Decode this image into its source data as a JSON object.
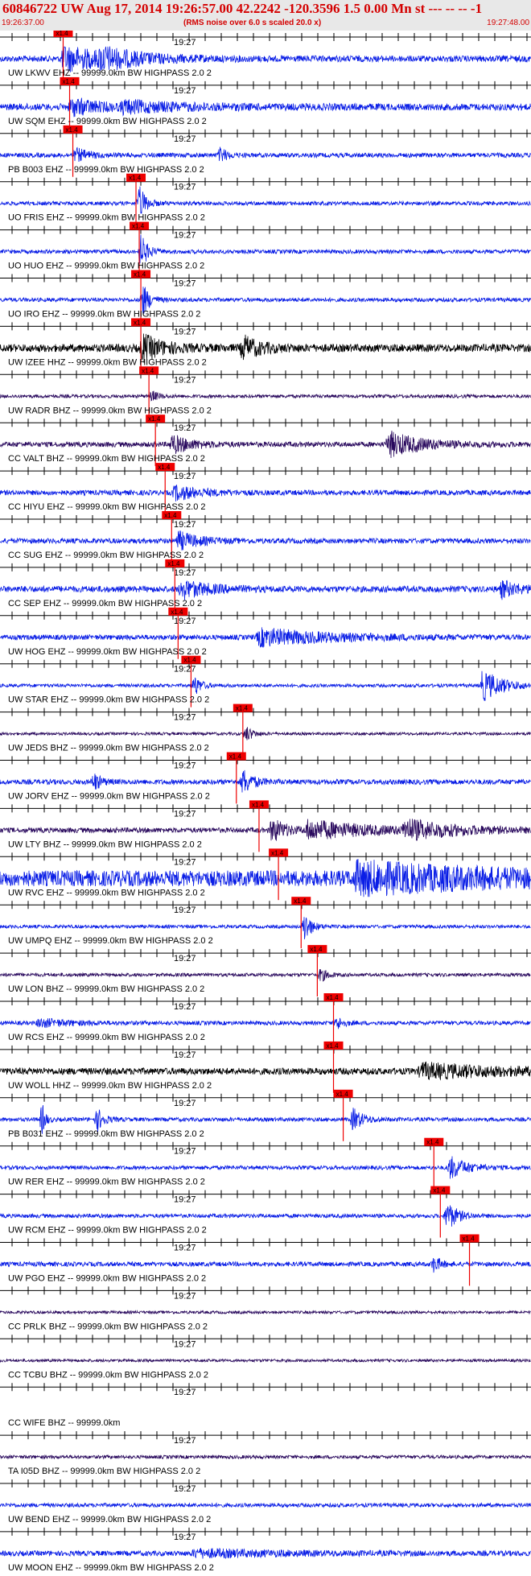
{
  "header": {
    "title": "60846722 UW Aug 17, 2014 19:26:57.00   42.2242 -120.3596  1.5 0.00 Mn st --- -- --   -1",
    "subtitle": "(RMS noise over 6.0 s scaled 20.0 x)",
    "start_time": "19:26:37.00",
    "end_time": "19:27:48.00"
  },
  "chart_data": {
    "type": "line",
    "title": "60846722 UW Aug 17, 2014 19:26:57.00   42.2242 -120.3596  1.5 0.00 Mn st --- -- --   -1",
    "subtitle": "(RMS noise over 6.0 s scaled 20.0 x)",
    "x_range": [
      "19:26:37.00",
      "19:27:48.00"
    ],
    "minute_marker_label": "19:27",
    "pick_label": "x1.4",
    "colors": {
      "blue": "#0a1ee6",
      "navy": "#2a0a5e",
      "black": "#000000",
      "pick": "#ee0000",
      "header_text": "#d40000"
    },
    "traces": [
      {
        "label": "UW LKWV EHZ -- 99999.0km BW  HIGHPASS  2.0  2",
        "color": "blue",
        "pick_s": 19.5,
        "amp": 0.55,
        "bursts": [
          [
            19.5,
            15,
            2.2
          ],
          [
            31,
            10,
            1.3
          ]
        ]
      },
      {
        "label": "UW SQM EHZ -- 99999.0km BW  HIGHPASS  2.0  2",
        "color": "blue",
        "pick_s": 21.5,
        "amp": 0.6,
        "bursts": [
          [
            22,
            8,
            1.5
          ],
          [
            38,
            20,
            0.8
          ]
        ]
      },
      {
        "label": "PB B003 EHZ -- 99999.0km BW  HIGHPASS  2.0  2",
        "color": "blue",
        "pick_s": 22.5,
        "amp": 0.4,
        "bursts": [
          [
            23.5,
            4,
            1.1
          ],
          [
            68,
            2,
            1.3
          ]
        ]
      },
      {
        "label": "UO FRIS EHZ -- 99999.0km BW  HIGHPASS  2.0  2",
        "color": "blue",
        "pick_s": 42.0,
        "amp": 0.35,
        "bursts": [
          [
            43,
            2,
            3
          ]
        ]
      },
      {
        "label": "UO HUO EHZ -- 99999.0km BW  HIGHPASS  2.0  2",
        "color": "blue",
        "pick_s": 43.0,
        "amp": 0.35,
        "bursts": [
          [
            43.5,
            2,
            3
          ]
        ]
      },
      {
        "label": "UO IRO EHZ -- 99999.0km BW  HIGHPASS  2.0  2",
        "color": "blue",
        "pick_s": 43.5,
        "amp": 0.35,
        "bursts": [
          [
            44,
            2,
            3
          ]
        ]
      },
      {
        "label": "UW IZEE HHZ -- 99999.0km BW  HIGHPASS  2.0  2",
        "color": "black",
        "pick_s": 43.5,
        "amp": 0.7,
        "bursts": [
          [
            44,
            6,
            2.2
          ],
          [
            75,
            5,
            2
          ]
        ]
      },
      {
        "label": "UW RADR BHZ -- 99999.0km BW  HIGHPASS  2.0  2",
        "color": "navy",
        "pick_s": 46.0,
        "amp": 0.3,
        "bursts": [
          [
            47,
            2,
            0.9
          ]
        ]
      },
      {
        "label": "CC VALT BHZ -- 99999.0km BW  HIGHPASS  2.0  2",
        "color": "navy",
        "pick_s": 48.0,
        "amp": 0.45,
        "bursts": [
          [
            53,
            6,
            1.6
          ],
          [
            120,
            10,
            2.2
          ]
        ]
      },
      {
        "label": "CC HIYU EHZ -- 99999.0km BW  HIGHPASS  2.0  2",
        "color": "blue",
        "pick_s": 51.0,
        "amp": 0.45,
        "bursts": [
          [
            54,
            8,
            1.2
          ]
        ]
      },
      {
        "label": "CC SUG EHZ -- 99999.0km BW  HIGHPASS  2.0  2",
        "color": "blue",
        "pick_s": 53.0,
        "amp": 0.45,
        "bursts": [
          [
            55,
            6,
            1.6
          ]
        ]
      },
      {
        "label": "CC SEP EHZ -- 99999.0km BW  HIGHPASS  2.0  2",
        "color": "blue",
        "pick_s": 54.0,
        "amp": 0.55,
        "bursts": [
          [
            56,
            8,
            1.6
          ],
          [
            155,
            5,
            1.4
          ]
        ]
      },
      {
        "label": "UW HOG EHZ -- 99999.0km BW  HIGHPASS  2.0  2",
        "color": "blue",
        "pick_s": 55.0,
        "amp": 0.45,
        "bursts": [
          [
            80,
            22,
            1.5
          ]
        ]
      },
      {
        "label": "UW STAR EHZ -- 99999.0km BW  HIGHPASS  2.0  2",
        "color": "blue",
        "pick_s": 59.0,
        "amp": 0.3,
        "bursts": [
          [
            60,
            2,
            1.8
          ],
          [
            149,
            6,
            2.8
          ]
        ]
      },
      {
        "label": "UW JEDS BHZ -- 99999.0km BW  HIGHPASS  2.0  2",
        "color": "navy",
        "pick_s": 75.0,
        "amp": 0.25,
        "bursts": [
          [
            76,
            2,
            1.4
          ]
        ]
      },
      {
        "label": "UW JORV EHZ -- 99999.0km BW  HIGHPASS  2.0  2",
        "color": "blue",
        "pick_s": 73.0,
        "amp": 0.45,
        "bursts": [
          [
            29,
            2,
            1.6
          ],
          [
            75,
            3,
            2.2
          ]
        ]
      },
      {
        "label": "UW LTY BHZ -- 99999.0km BW  HIGHPASS  2.0  2",
        "color": "navy",
        "pick_s": 80.0,
        "amp": 0.45,
        "bursts": [
          [
            84,
            4,
            2.2
          ],
          [
            95,
            20,
            1.6
          ],
          [
            125,
            14,
            1.6
          ]
        ]
      },
      {
        "label": "UW RVC EHZ -- 99999.0km BW  HIGHPASS  2.0  2",
        "color": "blue",
        "pick_s": 86.0,
        "amp": 1.4,
        "bursts": [
          [
            110,
            40,
            2.2
          ]
        ]
      },
      {
        "label": "UW UMPQ EHZ -- 99999.0km BW  HIGHPASS  2.0  2",
        "color": "blue",
        "pick_s": 93.0,
        "amp": 0.3,
        "bursts": [
          [
            94,
            2,
            2.8
          ]
        ]
      },
      {
        "label": "UW LON BHZ -- 99999.0km BW  HIGHPASS  2.0  2",
        "color": "navy",
        "pick_s": 98.0,
        "amp": 0.3,
        "bursts": [
          [
            99,
            2,
            1.2
          ]
        ]
      },
      {
        "label": "UW RCS EHZ -- 99999.0km BW  HIGHPASS  2.0  2",
        "color": "blue",
        "pick_s": 103.0,
        "amp": 0.35,
        "bursts": [
          [
            104,
            2,
            1.1
          ],
          [
            12,
            10,
            0.7
          ]
        ]
      },
      {
        "label": "UW WOLL HHZ -- 99999.0km BW  HIGHPASS  2.0  2",
        "color": "black",
        "pick_s": 103.0,
        "amp": 0.6,
        "bursts": [
          [
            130,
            25,
            1.2
          ]
        ]
      },
      {
        "label": "PB B031 EHZ -- 99999.0km BW  HIGHPASS  2.0  2",
        "color": "blue",
        "pick_s": 106.0,
        "amp": 0.35,
        "bursts": [
          [
            13,
            1,
            2.8
          ],
          [
            30,
            2,
            2
          ],
          [
            109,
            3,
            2
          ]
        ]
      },
      {
        "label": "UW RER EHZ -- 99999.0km BW  HIGHPASS  2.0  2",
        "color": "blue",
        "pick_s": 134.0,
        "amp": 0.35,
        "bursts": [
          [
            139,
            5,
            2
          ]
        ]
      },
      {
        "label": "UW RCM EHZ -- 99999.0km BW  HIGHPASS  2.0  2",
        "color": "blue",
        "pick_s": 136.0,
        "amp": 0.35,
        "bursts": [
          [
            138,
            3,
            2.6
          ]
        ]
      },
      {
        "label": "UW PGO EHZ -- 99999.0km BW  HIGHPASS  2.0  2",
        "color": "blue",
        "pick_s": 145.0,
        "amp": 0.4,
        "bursts": [
          [
            134,
            2,
            1.4
          ]
        ]
      },
      {
        "label": "CC PRLK BHZ -- 99999.0km BW  HIGHPASS  2.0  2",
        "color": "navy",
        "pick_s": null,
        "amp": 0.25,
        "bursts": []
      },
      {
        "label": "CC TCBU BHZ -- 99999.0km BW  HIGHPASS  2.0  2",
        "color": "navy",
        "pick_s": null,
        "amp": 0.25,
        "bursts": []
      },
      {
        "label": "CC WIFE BHZ -- 99999.0km",
        "color": "navy",
        "pick_s": null,
        "amp": 0,
        "bursts": []
      },
      {
        "label": "TA I05D BHZ -- 99999.0km BW  HIGHPASS  2.0  2",
        "color": "navy",
        "pick_s": null,
        "amp": 0.3,
        "bursts": []
      },
      {
        "label": "UW BEND EHZ -- 99999.0km BW  HIGHPASS  2.0  2",
        "color": "blue",
        "pick_s": null,
        "amp": 0.35,
        "bursts": []
      },
      {
        "label": "UW MOON EHZ -- 99999.0km BW  HIGHPASS  2.0  2",
        "color": "blue",
        "pick_s": null,
        "amp": 0.45,
        "bursts": [
          [
            60,
            30,
            0.6
          ]
        ]
      }
    ]
  }
}
